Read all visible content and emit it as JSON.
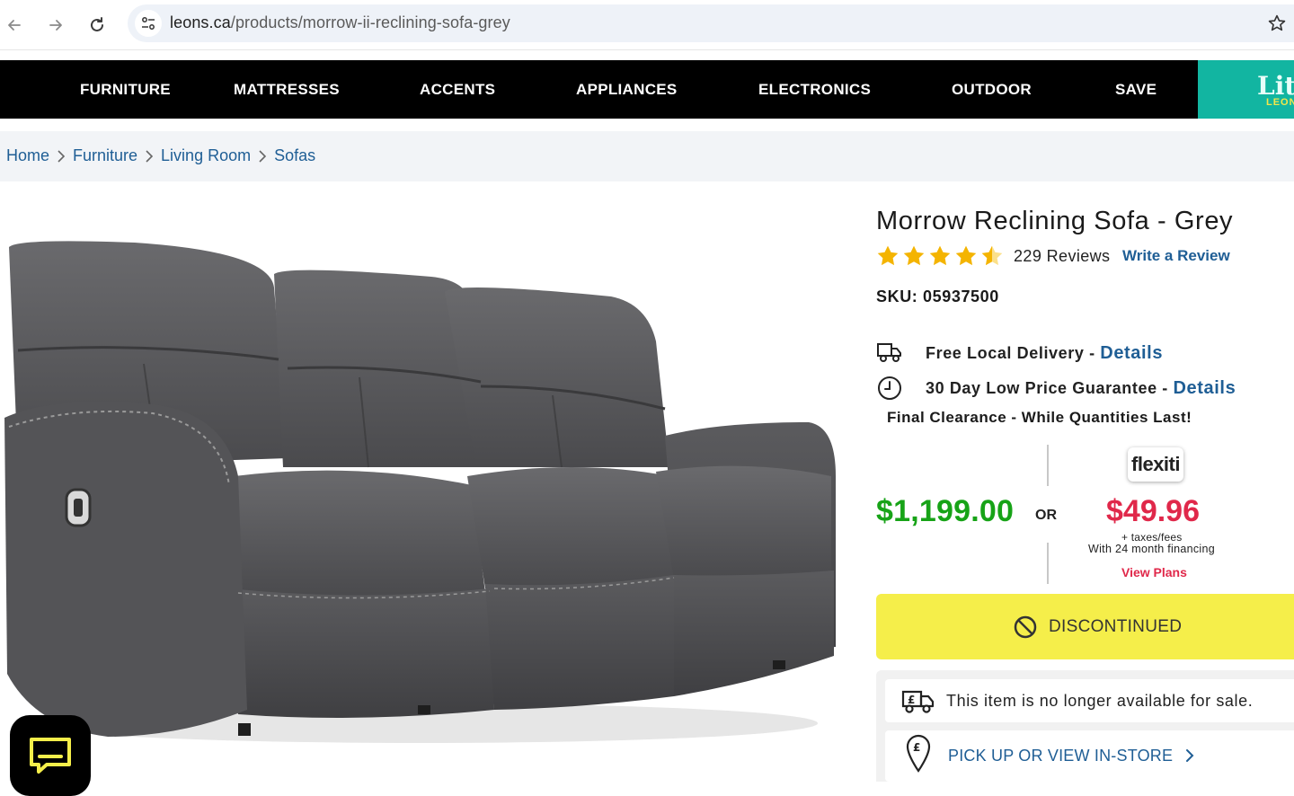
{
  "browser": {
    "url_host": "leons.ca",
    "url_path": "/products/morrow-ii-reclining-sofa-grey",
    "icons": [
      "back-arrow-icon",
      "forward-arrow-icon",
      "reload-icon",
      "site-settings-icon",
      "bookmark-star-icon"
    ]
  },
  "topnav": {
    "items": [
      "FURNITURE",
      "MATTRESSES",
      "ACCENTS",
      "APPLIANCES",
      "ELECTRONICS",
      "OUTDOOR",
      "SAVE"
    ],
    "brand_partial": "Litt",
    "brand_sub_partial": "LEON"
  },
  "breadcrumb": [
    "Home",
    "Furniture",
    "Living Room",
    "Sofas"
  ],
  "product": {
    "title": "Morrow Reclining Sofa - Grey",
    "rating": 4.5,
    "reviews_label": "229 Reviews",
    "write_review": "Write a Review",
    "sku_label": "SKU: 05937500",
    "features": [
      {
        "icon": "delivery-truck-icon",
        "text": "Free Local Delivery - ",
        "link": "Details"
      },
      {
        "icon": "clock-icon",
        "text": "30 Day Low Price Guarantee - ",
        "link": "Details"
      }
    ],
    "clearance": "Final Clearance - While Quantities Last!",
    "price": "$1,199.00",
    "or_label": "OR",
    "financing": {
      "brand": "flexiti",
      "price": "$49.96",
      "taxes_note": "+ taxes/fees",
      "term_note": "With 24 month financing",
      "view_plans": "View Plans"
    },
    "discontinued_label": "DISCONTINUED",
    "availability_note": "This item is no longer available for sale.",
    "pickup_label": "PICK UP OR VIEW IN-STORE"
  },
  "colors": {
    "nav_bg": "#000000",
    "brand_teal": "#12b5a1",
    "link_blue": "#1f5e95",
    "price_green": "#17a317",
    "finance_red": "#e0284a",
    "discontinued_yellow": "#f5ee4a"
  }
}
